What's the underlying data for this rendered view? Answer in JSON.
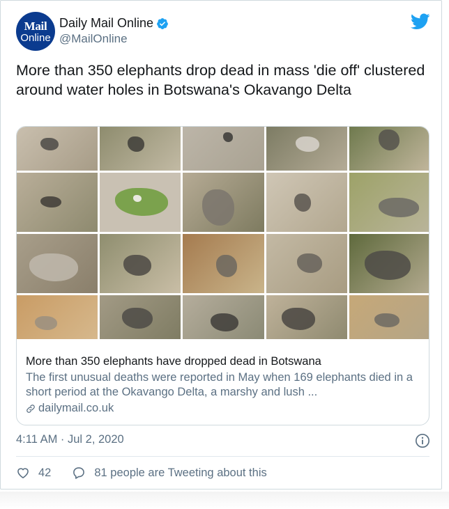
{
  "header": {
    "avatar_line1": "Mail",
    "avatar_line2": "Online",
    "display_name": "Daily Mail Online",
    "handle": "@MailOnline"
  },
  "tweet": {
    "text": "More than 350 elephants drop dead in mass 'die off' clustered around water holes in Botswana's Okavango Delta"
  },
  "link_card": {
    "title": "More than 350 elephants have dropped dead in Botswana",
    "description": "The first unusual deaths were reported in May when 169 elephants died in a short period at the Okavango Delta, a marshy and lush ...",
    "domain": "dailymail.co.uk"
  },
  "meta": {
    "timestamp": "4:11 AM · Jul 2, 2020"
  },
  "actions": {
    "likes": "42",
    "tweeting": "81 people are Tweeting about this"
  },
  "colors": {
    "twitter_blue": "#1da1f2",
    "avatar_bg": "#0b3b8f",
    "muted_text": "#5b7083"
  },
  "icons": [
    "twitter-bird-icon",
    "verified-badge-icon",
    "link-icon",
    "info-icon",
    "heart-icon",
    "reply-bubble-icon"
  ]
}
